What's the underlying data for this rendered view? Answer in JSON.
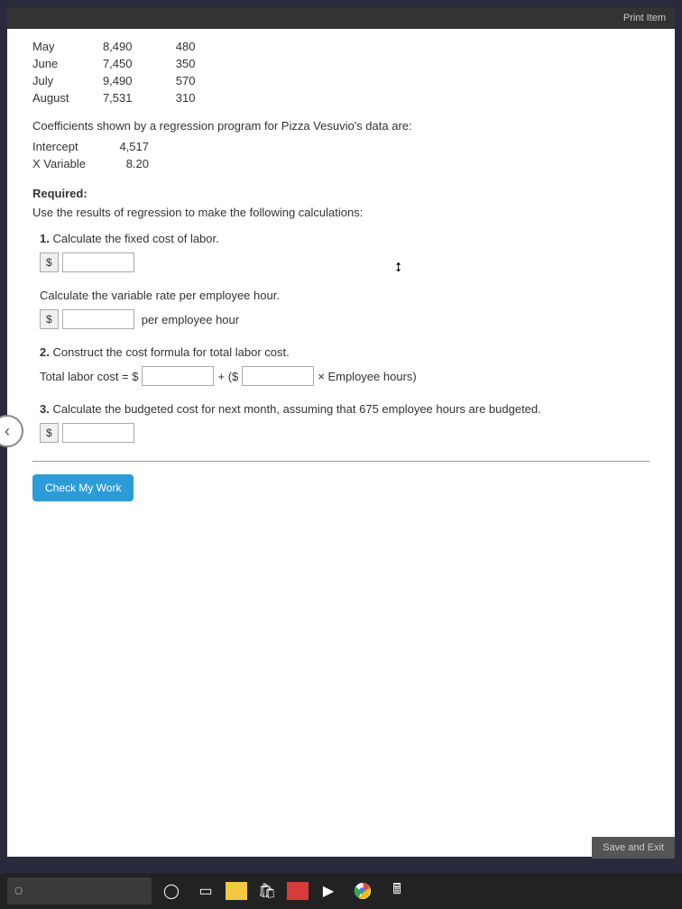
{
  "topbar": {
    "print": "Print Item"
  },
  "dataTable": {
    "rows": [
      {
        "month": "May",
        "col1": "8,490",
        "col2": "480"
      },
      {
        "month": "June",
        "col1": "7,450",
        "col2": "350"
      },
      {
        "month": "July",
        "col1": "9,490",
        "col2": "570"
      },
      {
        "month": "August",
        "col1": "7,531",
        "col2": "310"
      }
    ]
  },
  "coefText": "Coefficients shown by a regression program for Pizza Vesuvio's data are:",
  "coefTable": {
    "rows": [
      {
        "label": "Intercept",
        "value": "4,517"
      },
      {
        "label": "X Variable",
        "value": "8.20"
      }
    ]
  },
  "required": "Required:",
  "instruction": "Use the results of regression to make the following calculations:",
  "q1": {
    "num": "1.",
    "text": "Calculate the fixed cost of labor."
  },
  "q1b": {
    "text": "Calculate the variable rate per employee hour.",
    "suffix": "per employee hour"
  },
  "q2": {
    "num": "2.",
    "text": "Construct the cost formula for total labor cost.",
    "formula_prefix": "Total labor cost = $",
    "formula_plus": " + ($",
    "formula_suffix": " × Employee hours)"
  },
  "q3": {
    "num": "3.",
    "text": "Calculate the budgeted cost for next month, assuming that 675 employee hours are budgeted."
  },
  "buttons": {
    "checkWork": "Check My Work",
    "saveExit": "Save and Exit"
  },
  "taskbar": {
    "search": "O"
  }
}
